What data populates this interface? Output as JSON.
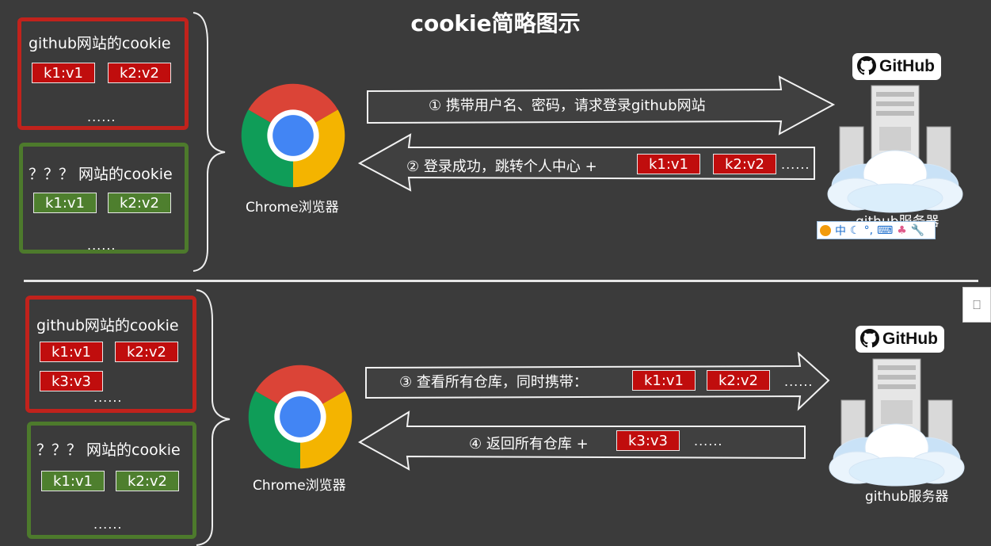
{
  "title": "cookie简略图示",
  "top": {
    "github_box": {
      "label": "github网站的cookie",
      "cookies": [
        "k1:v1",
        "k2:v2"
      ],
      "more": "......"
    },
    "other_box": {
      "label": "？？？ 网站的cookie",
      "cookies": [
        "k1:v1",
        "k2:v2"
      ],
      "more": "......"
    },
    "browser_label": "Chrome浏览器",
    "request_text": "① 携带用户名、密码，请求登录github网站",
    "response_text": "② 登录成功，跳转个人中心 +",
    "response_cookies": [
      "k1:v1",
      "k2:v2"
    ],
    "response_more": "......",
    "github_logo": "GitHub",
    "server_label": "github服务器"
  },
  "bottom": {
    "github_box": {
      "label": "github网站的cookie",
      "cookies": [
        "k1:v1",
        "k2:v2",
        "k3:v3"
      ],
      "more": "......"
    },
    "other_box": {
      "label": "？？？ 网站的cookie",
      "cookies": [
        "k1:v1",
        "k2:v2"
      ],
      "more": "......"
    },
    "browser_label": "Chrome浏览器",
    "request_text": "③ 查看所有仓库，同时携带：",
    "request_cookies": [
      "k1:v1",
      "k2:v2"
    ],
    "request_more": "......",
    "response_text": "④ 返回所有仓库 +",
    "response_cookies": [
      "k3:v3"
    ],
    "response_more": "......",
    "github_logo": "GitHub",
    "server_label": "github服务器"
  },
  "ime_toolbar": {
    "items": [
      "ime-logo-icon",
      "中",
      "moon-icon",
      "punctuation-icon",
      "keyboard-icon",
      "wrench-icon"
    ],
    "lang": "中"
  },
  "side_tab": {
    "icon": "bookmark-icon"
  },
  "colors": {
    "background": "#3b3b3b",
    "red_chip": "#c00d0d",
    "green_chip": "#4e7f2e",
    "red_border": "#c1221c",
    "green_border": "#4d7a2c"
  }
}
